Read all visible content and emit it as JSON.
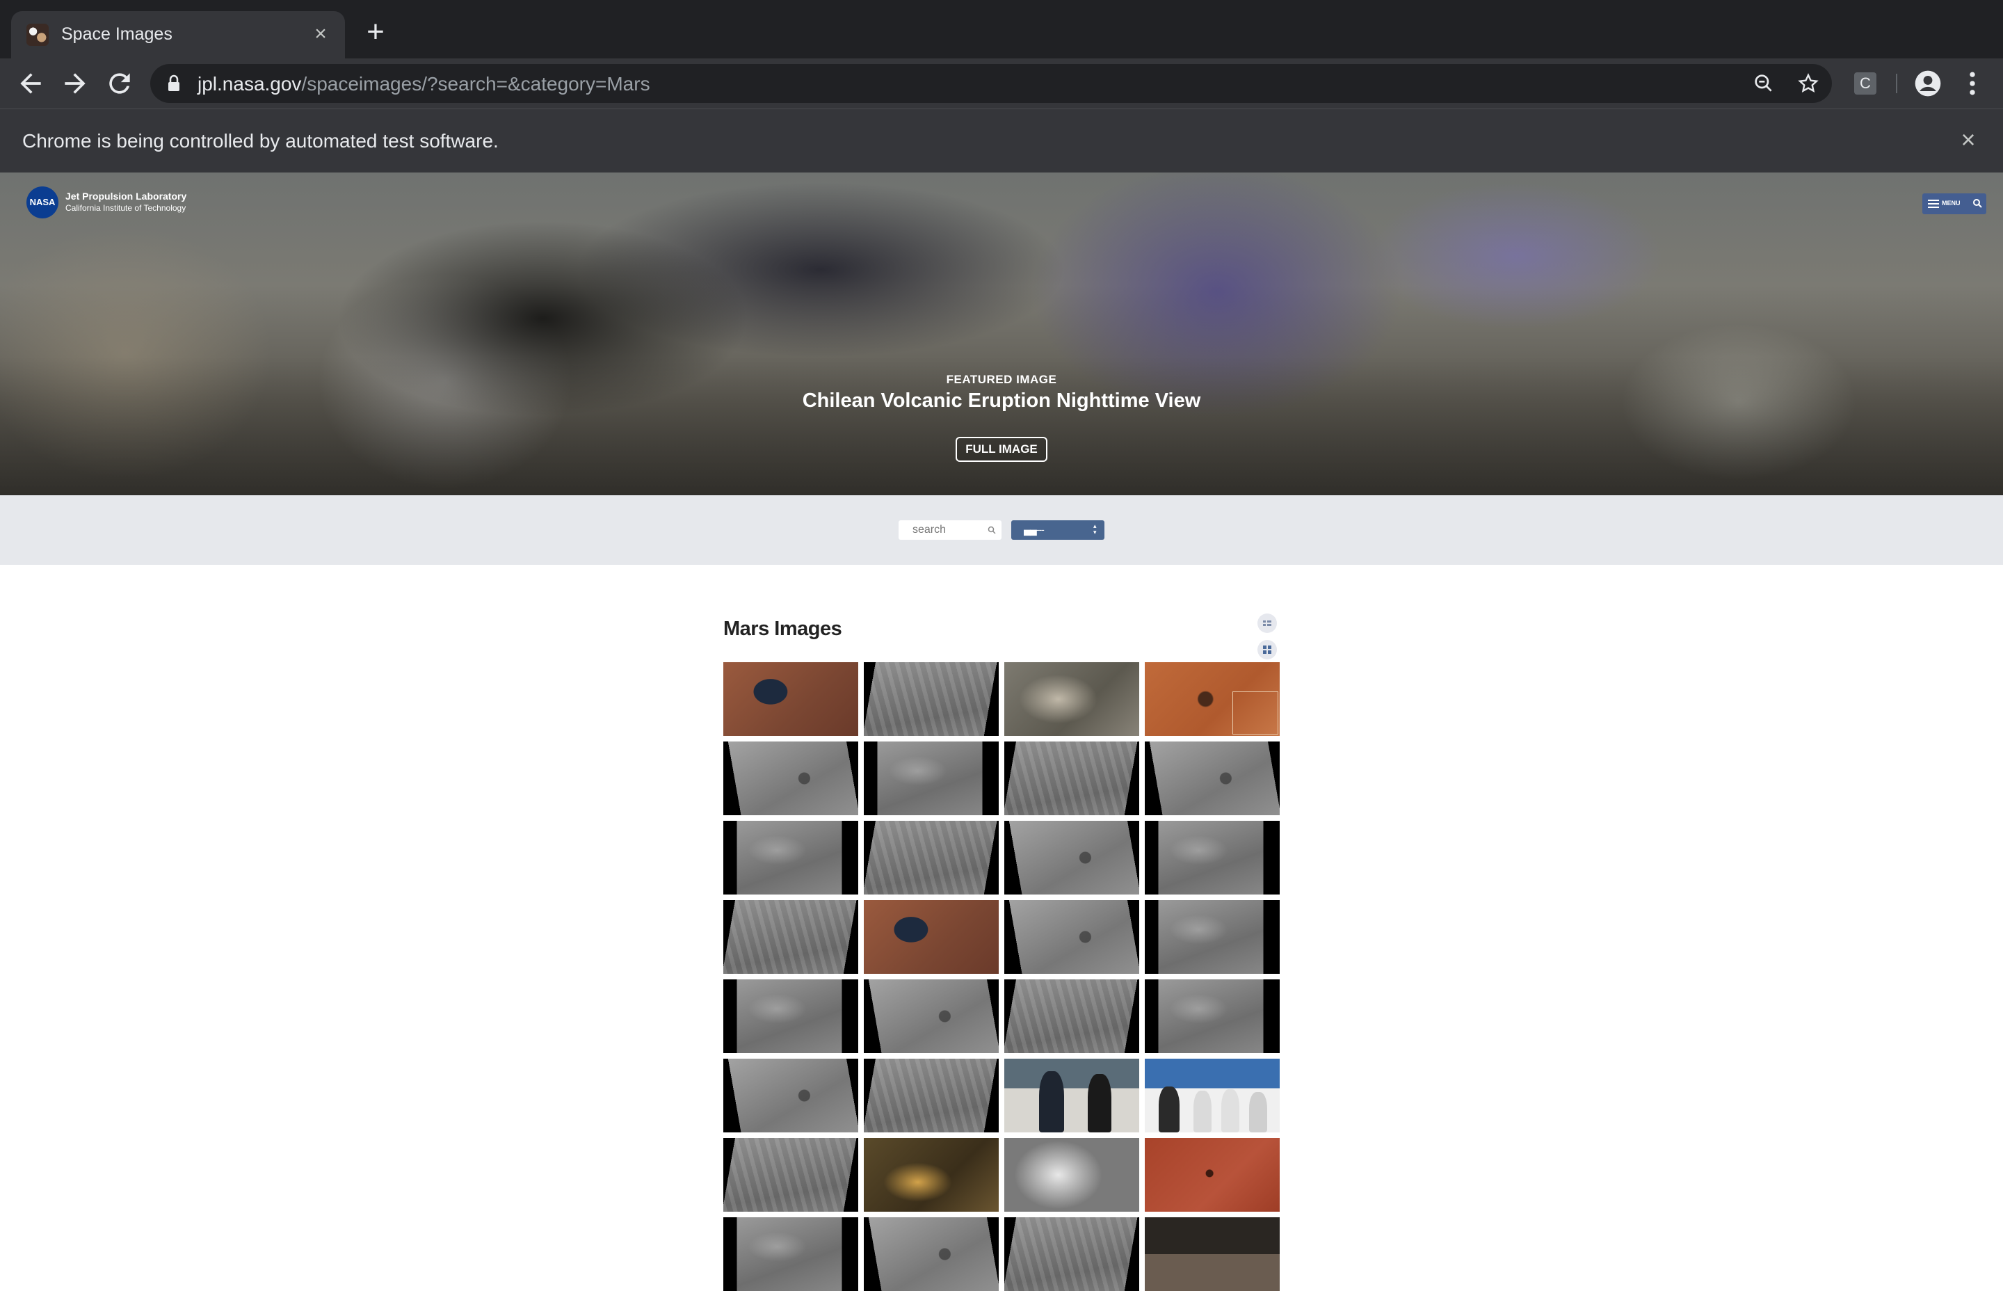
{
  "browser": {
    "tab_title": "Space Images",
    "url_host": "jpl.nasa.gov",
    "url_path": "/spaceimages/?search=&category=Mars",
    "extension_letter": "C",
    "infobar_text": "Chrome is being controlled by automated test software."
  },
  "header": {
    "logo_line1": "Jet Propulsion Laboratory",
    "logo_line2": "California Institute of Technology",
    "nasa_mark": "NASA",
    "menu_label": "MENU"
  },
  "featured": {
    "kicker": "FEATURED IMAGE",
    "title": "Chilean Volcanic Eruption Nighttime View",
    "button_label": "FULL IMAGE"
  },
  "search": {
    "placeholder": "search",
    "category_value": "▄▄---"
  },
  "gallery": {
    "title": "Mars Images",
    "thumbnails": [
      "mars-lander-image",
      "terrain-image",
      "rocky-surface-image",
      "crater-orange-image",
      "terrain-image",
      "terrain-image",
      "terrain-image",
      "terrain-image",
      "terrain-image",
      "terrain-image",
      "terrain-image",
      "terrain-image",
      "terrain-image",
      "mars-lander-image",
      "terrain-image",
      "terrain-image",
      "terrain-image",
      "terrain-image",
      "terrain-image",
      "terrain-image",
      "terrain-image",
      "terrain-image",
      "award-photo",
      "group-photo",
      "terrain-image",
      "cave-image",
      "crater-image",
      "red-surface-image",
      "terrain-image",
      "terrain-image",
      "terrain-image",
      "people-photo"
    ]
  },
  "colors": {
    "chrome_dark": "#202124",
    "chrome_toolbar": "#35363a",
    "search_band": "#e6e8ec",
    "select_blue": "#48658f"
  },
  "icons": {
    "back": "back-arrow-icon",
    "forward": "forward-arrow-icon",
    "reload": "reload-icon",
    "lock": "lock-icon",
    "zoom": "zoom-icon",
    "star": "star-icon",
    "account": "account-icon",
    "more": "more-vertical-icon",
    "list_view": "list-view-icon",
    "grid_view": "grid-view-icon"
  }
}
